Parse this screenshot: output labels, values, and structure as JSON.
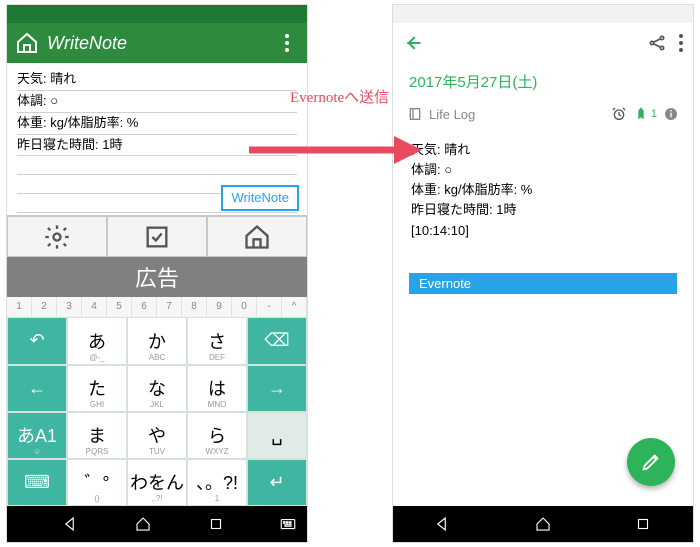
{
  "annotation": "Evernoteへ送信",
  "left": {
    "app_title": "WriteNote",
    "note_lines": [
      "天気: 晴れ",
      "体調: ○",
      "体重: kg/体脂肪率: %",
      "昨日寝た時間: 1時"
    ],
    "badge": "WriteNote",
    "ad": "広告",
    "kbd_nums": [
      "1",
      "2",
      "3",
      "4",
      "5",
      "6",
      "7",
      "8",
      "9",
      "0",
      "-",
      "^"
    ],
    "kbd": {
      "r1": [
        {
          "t": "↶",
          "d": 1
        },
        {
          "t": "あ",
          "s": "@-_"
        },
        {
          "t": "か",
          "s": "ABC"
        },
        {
          "t": "さ",
          "s": "DEF"
        },
        {
          "t": "⌫",
          "d": 1
        }
      ],
      "r2": [
        {
          "t": "←",
          "d": 1
        },
        {
          "t": "た",
          "s": "GHI"
        },
        {
          "t": "な",
          "s": "JKL"
        },
        {
          "t": "は",
          "s": "MNO"
        },
        {
          "t": "→",
          "d": 1
        }
      ],
      "r3": [
        {
          "t": "あA1",
          "d": 1,
          "s": "☺"
        },
        {
          "t": "ま",
          "s": "PQRS"
        },
        {
          "t": "や",
          "s": "TUV"
        },
        {
          "t": "ら",
          "s": "WXYZ"
        },
        {
          "t": "␣",
          "m": 1
        }
      ],
      "r4": [
        {
          "t": "⌨",
          "d": 1
        },
        {
          "t": "゛°",
          "s": "()"
        },
        {
          "t": "わをん",
          "s": ",.?!"
        },
        {
          "t": "、。?!",
          "s": "1"
        },
        {
          "t": "↵",
          "d": 1
        }
      ]
    }
  },
  "right": {
    "date": "2017年5月27日(土)",
    "lifelog": "Life Log",
    "badge_count": "1",
    "content_lines": [
      "天気: 晴れ",
      "体調: ○",
      "体重: kg/体脂肪率: %",
      "昨日寝た時間: 1時",
      "[10:14:10]"
    ],
    "badge": "Evernote"
  }
}
